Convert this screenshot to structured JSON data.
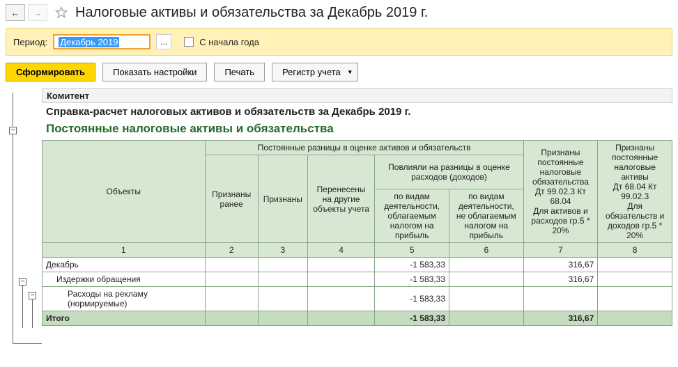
{
  "nav": {
    "back": "←",
    "forward": "→"
  },
  "title": "Налоговые активы и обязательства за Декабрь 2019 г.",
  "period": {
    "label": "Период:",
    "value": "Декабрь 2019",
    "picker": "...",
    "from_start_label": "С начала года"
  },
  "actions": {
    "generate": "Сформировать",
    "settings": "Показать настройки",
    "print": "Печать",
    "register": "Регистр учета"
  },
  "report": {
    "org": "Комитент",
    "title": "Справка-расчет налоговых активов и обязательств за Декабрь 2019 г.",
    "section": "Постоянные налоговые активы и обязательства",
    "headers": {
      "objects": "Объекты",
      "perm_diff": "Постоянные разницы в оценке активов и обязательств",
      "recognized_before": "Признаны ранее",
      "recognized": "Признаны",
      "transferred": "Перенесены на другие объекты учета",
      "affected": "Повлияли на разницы в оценке расходов (доходов)",
      "by_taxable": "по видам деятельности, облагаемым налогом на прибыль",
      "by_nontaxable": "по видам деятельности, не облагаемым налогом на прибыль",
      "col7": "Признаны постоянные налоговые обязательства\nДт 99.02.3 Кт 68.04\nДля активов и расходов гр.5 * 20%",
      "col8": "Признаны постоянные налоговые активы\nДт 68.04 Кт 99.02.3\nДля обязательств и доходов гр.5 * 20%"
    },
    "colnums": [
      "1",
      "2",
      "3",
      "4",
      "5",
      "6",
      "7",
      "8"
    ],
    "rows": [
      {
        "label": "Декабрь",
        "indent": 0,
        "c5": "-1 583,33",
        "c7": "316,67"
      },
      {
        "label": "Издержки обращения",
        "indent": 1,
        "c5": "-1 583,33",
        "c7": "316,67"
      },
      {
        "label": "Расходы на рекламу (нормируемые)",
        "indent": 2,
        "c5": "-1 583,33",
        "c7": ""
      }
    ],
    "total": {
      "label": "Итого",
      "c5": "-1 583,33",
      "c7": "316,67"
    }
  }
}
